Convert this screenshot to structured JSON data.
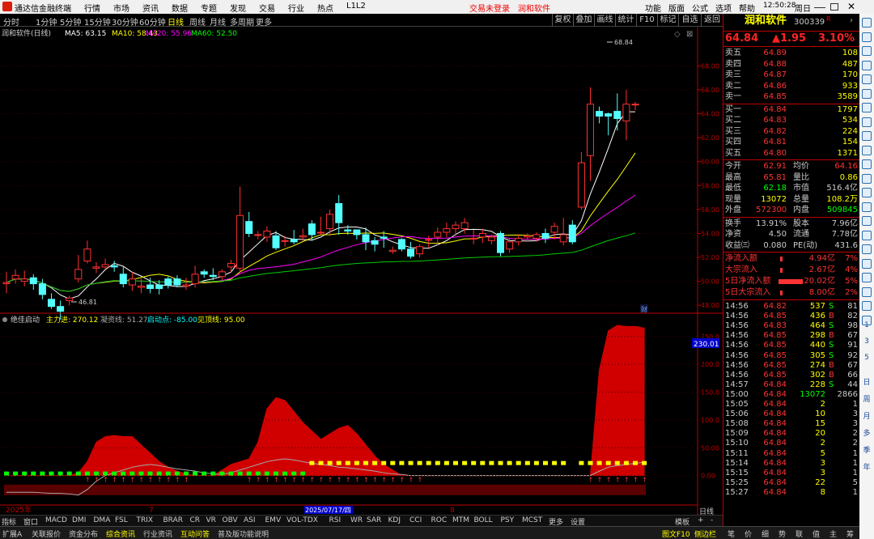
{
  "titlebar": {
    "app_name": "通达信金融终端",
    "menus": [
      "行情",
      "市场",
      "资讯",
      "数据",
      "专题",
      "发现",
      "交易",
      "行业",
      "热点",
      "L1L2"
    ],
    "trade_status": "交易未登录",
    "stock_link": "润和软件",
    "right_menus": [
      "功能",
      "版面",
      "公式",
      "选项",
      "帮助"
    ],
    "time": "12:50:28",
    "weekday": "周日"
  },
  "period_bar": {
    "items": [
      "分时",
      "1分钟",
      "5分钟",
      "15分钟",
      "30分钟",
      "60分钟",
      "日线",
      "周线",
      "月线",
      "多周期",
      "更多"
    ],
    "selected": "日线",
    "right_buttons": [
      "复权",
      "叠加",
      "画线",
      "统计",
      "F10",
      "标记",
      "自选",
      "返回"
    ]
  },
  "main_chart_legend": {
    "stock": "润和软件(日线)",
    "ma5": "MA5: 63.15",
    "ma10": "MA10: 58.43",
    "ma20": "MA20: 55.96",
    "ma60": "MA60: 52.50"
  },
  "indicator_legend": {
    "name": "绝佳启动",
    "main_in": "主力进: 270.12",
    "gather": "凝资线: 51.27",
    "start": "启动点: -85.00",
    "top": "见顶线: 95.00"
  },
  "chart_data": [
    {
      "type": "candlestick",
      "price_axis": [
        "68.00",
        "66.00",
        "64.00",
        "62.00",
        "60.00",
        "58.00",
        "56.00",
        "54.00",
        "52.00",
        "50.00",
        "48.00"
      ],
      "ylim": [
        47,
        70
      ],
      "high_label": "68.84",
      "low_label": "46.81",
      "candles": [
        [
          49.8,
          49.9,
          49.0,
          50.8
        ],
        [
          50.2,
          50.5,
          49.8,
          51.0
        ],
        [
          50.0,
          50.2,
          49.6,
          50.9
        ],
        [
          50.3,
          49.8,
          49.3,
          50.6
        ],
        [
          49.8,
          48.9,
          48.5,
          50.2
        ],
        [
          48.5,
          47.9,
          47.7,
          49.0
        ],
        [
          47.9,
          47.5,
          46.8,
          48.4
        ],
        [
          48.4,
          48.6,
          48.0,
          48.8
        ],
        [
          50.2,
          51.0,
          49.9,
          52.2
        ],
        [
          51.7,
          52.7,
          51.5,
          53.4
        ],
        [
          51.1,
          51.2,
          50.7,
          51.6
        ],
        [
          51.2,
          51.4,
          51.0,
          51.9
        ],
        [
          51.3,
          51.2,
          50.8,
          51.7
        ],
        [
          50.6,
          49.8,
          49.5,
          51.2
        ],
        [
          49.7,
          50.2,
          49.2,
          50.8
        ],
        [
          49.5,
          49.6,
          49.0,
          50.2
        ],
        [
          49.7,
          49.4,
          49.0,
          50.3
        ],
        [
          49.7,
          49.4,
          48.9,
          50.1
        ],
        [
          50.2,
          49.7,
          49.4,
          50.4
        ],
        [
          50.2,
          49.7,
          49.5,
          50.5
        ],
        [
          49.6,
          49.7,
          49.3,
          50.3
        ],
        [
          49.8,
          50.6,
          49.5,
          51.3
        ],
        [
          50.8,
          50.6,
          50.3,
          51.0
        ],
        [
          50.5,
          50.4,
          50.1,
          51.1
        ],
        [
          50.4,
          50.8,
          50.1,
          51.0
        ],
        [
          51.2,
          51.5,
          50.7,
          51.8
        ],
        [
          51.1,
          55.5,
          50.7,
          57.9
        ],
        [
          55.0,
          54.0,
          53.7,
          55.8
        ],
        [
          53.9,
          53.9,
          53.5,
          54.2
        ],
        [
          53.7,
          54.2,
          53.3,
          54.6
        ],
        [
          53.8,
          52.8,
          52.6,
          54.2
        ],
        [
          53.4,
          53.4,
          52.9,
          53.8
        ],
        [
          53.5,
          53.3,
          53.1,
          54.3
        ],
        [
          53.7,
          53.8,
          53.4,
          54.4
        ],
        [
          54.8,
          53.9,
          53.4,
          55.1
        ],
        [
          54.1,
          54.1,
          53.9,
          55.4
        ],
        [
          54.4,
          55.6,
          53.8,
          56.0
        ],
        [
          56.5,
          54.9,
          53.9,
          57.2
        ],
        [
          54.3,
          54.2,
          53.9,
          54.7
        ],
        [
          54.3,
          53.9,
          53.5,
          54.3
        ],
        [
          53.9,
          53.3,
          52.6,
          54.5
        ],
        [
          53.4,
          53.1,
          52.5,
          53.7
        ],
        [
          53.7,
          53.6,
          52.8,
          54.2
        ],
        [
          52.5,
          52.6,
          52.3,
          52.9
        ],
        [
          53.5,
          52.7,
          52.5,
          53.6
        ],
        [
          52.7,
          52.1,
          51.9,
          53.3
        ],
        [
          52.3,
          52.9,
          52.0,
          53.1
        ],
        [
          53.5,
          53.5,
          52.8,
          53.8
        ],
        [
          53.7,
          54.1,
          53.0,
          54.5
        ],
        [
          54.1,
          54.4,
          53.7,
          54.9
        ],
        [
          54.4,
          54.7,
          53.8,
          55.0
        ],
        [
          54.4,
          54.9,
          54.0,
          55.3
        ],
        [
          53.6,
          53.6,
          53.1,
          54.3
        ],
        [
          53.7,
          54.0,
          53.2,
          54.4
        ],
        [
          53.4,
          53.7,
          53.1,
          53.9
        ],
        [
          54.0,
          52.4,
          52.1,
          54.2
        ],
        [
          52.7,
          53.3,
          52.4,
          53.6
        ],
        [
          53.3,
          53.6,
          53.0,
          53.9
        ],
        [
          53.7,
          53.8,
          53.3,
          54.0
        ],
        [
          53.6,
          53.9,
          53.3,
          54.1
        ],
        [
          54.0,
          53.6,
          53.2,
          54.4
        ],
        [
          54.1,
          54.6,
          53.5,
          54.9
        ],
        [
          53.3,
          53.9,
          53.0,
          55.3
        ],
        [
          54.7,
          53.3,
          53.1,
          55.1
        ],
        [
          56.2,
          59.9,
          56.0,
          60.8
        ],
        [
          60.5,
          64.8,
          58.4,
          66.2
        ],
        [
          64.2,
          63.8,
          63.2,
          64.6
        ],
        [
          64.0,
          63.8,
          62.2,
          64.1
        ],
        [
          64.2,
          63.6,
          62.6,
          65.7
        ],
        [
          63.4,
          64.8,
          61.8,
          66.0
        ],
        [
          64.8,
          64.8,
          64.3,
          65.0
        ]
      ]
    },
    {
      "type": "area",
      "name": "绝佳启动",
      "value_axis": [
        "250.0",
        "200.0",
        "150.0",
        "100.0",
        "50.00",
        "0.00"
      ],
      "current_value": "230.01",
      "ylim": [
        -50,
        270
      ],
      "main_in": [
        0,
        0,
        0,
        0,
        0,
        0,
        0,
        0,
        5,
        25,
        60,
        70,
        72,
        70,
        70,
        55,
        40,
        25,
        15,
        8,
        3,
        0,
        0,
        0,
        10,
        20,
        25,
        30,
        60,
        120,
        140,
        135,
        115,
        95,
        80,
        65,
        75,
        85,
        90,
        75,
        55,
        35,
        20,
        10,
        0,
        0,
        0,
        0,
        0,
        0,
        0,
        0,
        0,
        0,
        0,
        0,
        0,
        0,
        0,
        0,
        0,
        0,
        0,
        0,
        0,
        0,
        190,
        260,
        270,
        268,
        268,
        265
      ],
      "gather": [
        -30,
        -30,
        -30,
        -30,
        -31,
        -32,
        -32,
        -33,
        -35,
        -25,
        -10,
        0,
        5,
        10,
        15,
        18,
        20,
        18,
        15,
        12,
        10,
        8,
        5,
        3,
        2,
        5,
        10,
        15,
        20,
        25,
        28,
        30,
        28,
        25,
        22,
        20,
        18,
        15,
        14,
        12,
        10,
        8,
        5,
        3,
        2,
        0,
        0,
        0,
        0,
        0,
        0,
        0,
        0,
        0,
        0,
        0,
        0,
        0,
        0,
        0,
        0,
        0,
        0,
        0,
        0,
        0,
        8,
        15,
        18,
        20,
        22,
        24
      ]
    }
  ],
  "axis_dates": {
    "year": "2025年",
    "month7": "7",
    "date_highlight": "2025/07/17/四",
    "month8": "8"
  },
  "indicator_tabs": [
    "指标",
    "窗口",
    "MACD",
    "DMI",
    "DMA",
    "FSL",
    "TRIX",
    "BRAR",
    "CR",
    "VR",
    "OBV",
    "ASI",
    "EMV",
    "VOL-TDX",
    "RSI",
    "WR",
    "SAR",
    "KDJ",
    "CCI",
    "ROC",
    "MTM",
    "BOLL",
    "PSY",
    "MCST",
    "更多",
    "设置"
  ],
  "tabs_right": [
    "模板",
    "+",
    "-"
  ],
  "daily_label": "日线",
  "bottom_bar": [
    "扩展A",
    "关联报价",
    "资金分布",
    "综合资讯",
    "行业资讯",
    "互动问答",
    "普及版功能说明"
  ],
  "bottom_right": [
    "图文F10",
    "侧边栏"
  ],
  "bottom_right_tabs": [
    "笔",
    "价",
    "细",
    "势",
    "联",
    "值",
    "主",
    "筹"
  ],
  "quote": {
    "name": "润和软件",
    "code": "300339",
    "flag": "R",
    "price": "64.84",
    "change": "▲1.95",
    "pct": "3.10%",
    "asks": [
      [
        "卖五",
        "64.89",
        "108"
      ],
      [
        "卖四",
        "64.88",
        "487"
      ],
      [
        "卖三",
        "64.87",
        "170"
      ],
      [
        "卖二",
        "64.86",
        "933"
      ],
      [
        "卖一",
        "64.85",
        "3589"
      ]
    ],
    "bids": [
      [
        "买一",
        "64.84",
        "1797"
      ],
      [
        "买二",
        "64.83",
        "534"
      ],
      [
        "买三",
        "64.82",
        "224"
      ],
      [
        "买四",
        "64.81",
        "154"
      ],
      [
        "买五",
        "64.80",
        "1371"
      ]
    ],
    "stats": [
      [
        "今开",
        "62.91",
        "均价",
        "64.16"
      ],
      [
        "最高",
        "65.81",
        "量比",
        "0.86"
      ],
      [
        "最低",
        "62.18",
        "市值",
        "516.4亿"
      ],
      [
        "现量",
        "13072",
        "总量",
        "108.2万"
      ],
      [
        "外盘",
        "572300",
        "内盘",
        "509845"
      ]
    ],
    "stats2": [
      [
        "换手",
        "13.91%",
        "股本",
        "7.96亿"
      ],
      [
        "净资",
        "4.50",
        "流通",
        "7.78亿"
      ],
      [
        "收益㈢",
        "0.080",
        "PE(动)",
        "431.6"
      ]
    ],
    "flows": [
      [
        "净流入额",
        "4.94亿",
        "7%"
      ],
      [
        "大宗流入",
        "2.67亿",
        "4%"
      ],
      [
        "5日净流入额",
        "20.02亿",
        "5%"
      ],
      [
        "5日大宗流入",
        "8.00亿",
        "2%"
      ]
    ],
    "ticks": [
      [
        "14:56",
        "64.82",
        "537",
        "S",
        "81"
      ],
      [
        "14:56",
        "64.85",
        "436",
        "B",
        "82"
      ],
      [
        "14:56",
        "64.83",
        "464",
        "S",
        "98"
      ],
      [
        "14:56",
        "64.85",
        "298",
        "B",
        "67"
      ],
      [
        "14:56",
        "64.85",
        "440",
        "S",
        "91"
      ],
      [
        "14:56",
        "64.85",
        "305",
        "S",
        "92"
      ],
      [
        "14:56",
        "64.85",
        "274",
        "B",
        "67"
      ],
      [
        "14:56",
        "64.85",
        "302",
        "B",
        "66"
      ],
      [
        "14:57",
        "64.84",
        "228",
        "S",
        "44"
      ],
      [
        "15:00",
        "64.84",
        "13072",
        "",
        "2866"
      ],
      [
        "15:05",
        "64.84",
        "2",
        "",
        "1"
      ],
      [
        "15:06",
        "64.84",
        "10",
        "",
        "3"
      ],
      [
        "15:08",
        "64.84",
        "15",
        "",
        "3"
      ],
      [
        "15:09",
        "64.84",
        "20",
        "",
        "2"
      ],
      [
        "15:10",
        "64.84",
        "2",
        "",
        "2"
      ],
      [
        "15:11",
        "64.84",
        "5",
        "",
        "1"
      ],
      [
        "15:14",
        "64.84",
        "3",
        "",
        "1"
      ],
      [
        "15:15",
        "64.84",
        "3",
        "",
        "1"
      ],
      [
        "15:25",
        "64.84",
        "22",
        "",
        "5"
      ],
      [
        "15:27",
        "64.84",
        "8",
        "",
        "1"
      ]
    ]
  },
  "side_icons": [
    "日",
    "周",
    "月",
    "多",
    "季",
    "年"
  ],
  "side_nums": [
    "1",
    "3",
    "5"
  ]
}
